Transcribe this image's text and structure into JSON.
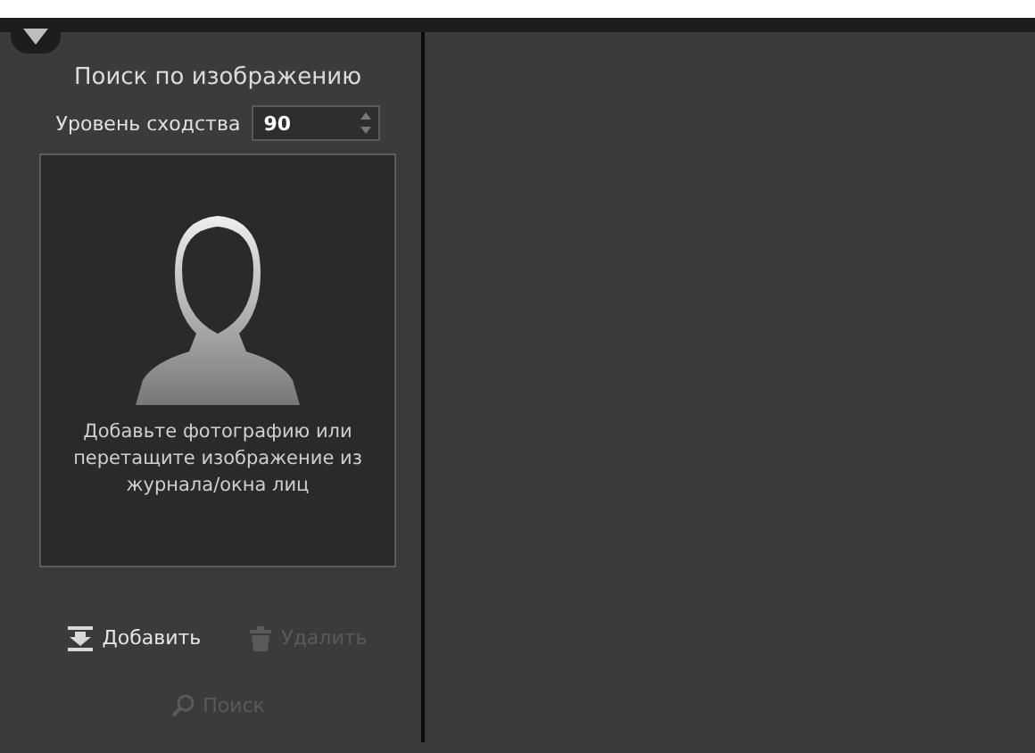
{
  "panel": {
    "title": "Поиск по изображению",
    "similarity": {
      "label": "Уровень сходства",
      "value": "90"
    },
    "drop_zone": {
      "hint": "Добавьте фотографию или перетащите изображение из журнала/окна лиц"
    },
    "buttons": [
      {
        "kind": "add",
        "label": "Добавить",
        "disabled": false
      },
      {
        "kind": "delete",
        "label": "Удалить",
        "disabled": true
      }
    ],
    "search_button": {
      "label": "Поиск",
      "disabled": true
    }
  }
}
